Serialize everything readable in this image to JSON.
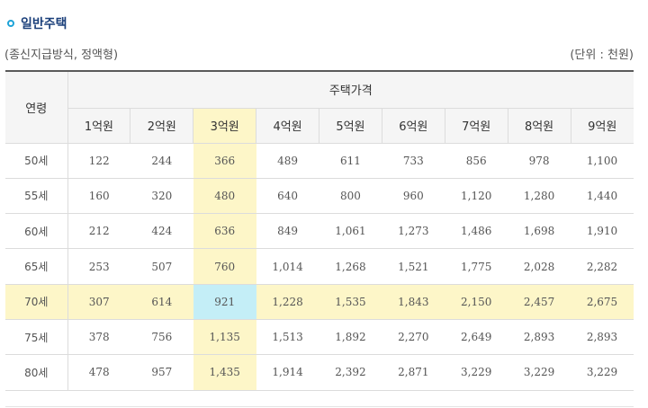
{
  "section": {
    "title": "일반주택",
    "bullet_color": "#1ea3d8"
  },
  "caption": {
    "left": "(종신지급방식, 정액형)",
    "right": "(단위 : 천원)"
  },
  "table": {
    "age_header": "연령",
    "price_group_header": "주택가격",
    "price_columns": [
      "1억원",
      "2억원",
      "3억원",
      "4억원",
      "5억원",
      "6억원",
      "7억원",
      "8억원",
      "9억원"
    ],
    "highlight_column_index": 2,
    "highlight_row_index": 4,
    "highlight_colors": {
      "column": "#fdf6c8",
      "row": "#fdf6c8",
      "intersection": "#c4eef7"
    },
    "rows": [
      {
        "age": "50세",
        "values": [
          "122",
          "244",
          "366",
          "489",
          "611",
          "733",
          "856",
          "978",
          "1,100"
        ]
      },
      {
        "age": "55세",
        "values": [
          "160",
          "320",
          "480",
          "640",
          "800",
          "960",
          "1,120",
          "1,280",
          "1,440"
        ]
      },
      {
        "age": "60세",
        "values": [
          "212",
          "424",
          "636",
          "849",
          "1,061",
          "1,273",
          "1,486",
          "1,698",
          "1,910"
        ]
      },
      {
        "age": "65세",
        "values": [
          "253",
          "507",
          "760",
          "1,014",
          "1,268",
          "1,521",
          "1,775",
          "2,028",
          "2,282"
        ]
      },
      {
        "age": "70세",
        "values": [
          "307",
          "614",
          "921",
          "1,228",
          "1,535",
          "1,843",
          "2,150",
          "2,457",
          "2,675"
        ]
      },
      {
        "age": "75세",
        "values": [
          "378",
          "756",
          "1,135",
          "1,513",
          "1,892",
          "2,270",
          "2,649",
          "2,893",
          "2,893"
        ]
      },
      {
        "age": "80세",
        "values": [
          "478",
          "957",
          "1,435",
          "1,914",
          "2,392",
          "2,871",
          "3,229",
          "3,229",
          "3,229"
        ]
      }
    ]
  }
}
